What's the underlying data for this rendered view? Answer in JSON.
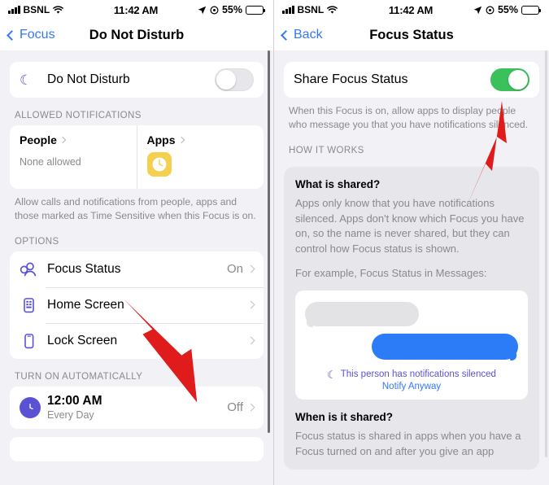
{
  "status_bar": {
    "carrier": "BSNL",
    "time": "11:42 AM",
    "battery_percent": "55%",
    "wifi_icon": "wifi-icon",
    "location_icon": "location-arrow-icon",
    "focus_icon": "focus-indicator-icon"
  },
  "left_panel": {
    "nav": {
      "back_label": "Focus",
      "title": "Do Not Disturb"
    },
    "dnd_row": {
      "label": "Do Not Disturb",
      "icon": "moon-icon",
      "toggle_state": "off"
    },
    "allowed_section": {
      "header": "ALLOWED NOTIFICATIONS",
      "people": {
        "title": "People",
        "subtitle": "None allowed"
      },
      "apps": {
        "title": "Apps",
        "app_icon": "clock-app-icon"
      },
      "footnote": "Allow calls and notifications from people, apps and those marked as Time Sensitive when this Focus is on."
    },
    "options_section": {
      "header": "OPTIONS",
      "rows": [
        {
          "label": "Focus Status",
          "value": "On",
          "icon": "focus-status-icon"
        },
        {
          "label": "Home Screen",
          "value": "",
          "icon": "home-screen-icon"
        },
        {
          "label": "Lock Screen",
          "value": "",
          "icon": "lock-screen-icon"
        }
      ]
    },
    "schedule_section": {
      "header": "TURN ON AUTOMATICALLY",
      "row": {
        "time": "12:00 AM",
        "repeat": "Every Day",
        "value": "Off",
        "icon": "clock-icon"
      }
    }
  },
  "right_panel": {
    "nav": {
      "back_label": "Back",
      "title": "Focus Status"
    },
    "share_row": {
      "label": "Share Focus Status",
      "toggle_state": "on"
    },
    "share_footnote": "When this Focus is on, allow apps to display people who message you that you have notifications silenced.",
    "how_it_works_header": "HOW IT WORKS",
    "what_is_shared": {
      "heading": "What is shared?",
      "paragraph": "Apps only know that you have notifications silenced. Apps don't know which Focus you have on, so the name is never shared, but they can control how Focus status is shown.",
      "example_label": "For example, Focus Status in Messages:",
      "preview": {
        "silenced_text": "This person has notifications silenced",
        "notify_link": "Notify Anyway",
        "moon_icon": "moon-icon"
      }
    },
    "when_is_it_shared": {
      "heading": "When is it shared?",
      "paragraph": "Focus status is shared in apps when you have a Focus turned on and after you give an app"
    }
  },
  "annotations": {
    "arrow_color": "#e01b1b",
    "arrows": [
      {
        "name": "arrow-pointing-to-focus-status"
      },
      {
        "name": "arrow-pointing-to-share-focus-status-toggle"
      }
    ]
  },
  "colors": {
    "accent_blue": "#3478f6",
    "toggle_green": "#3ac15b",
    "purple": "#5a52d5",
    "clock_app_yellow": "#f5cf4e",
    "bubble_blue": "#2b7cf6"
  }
}
